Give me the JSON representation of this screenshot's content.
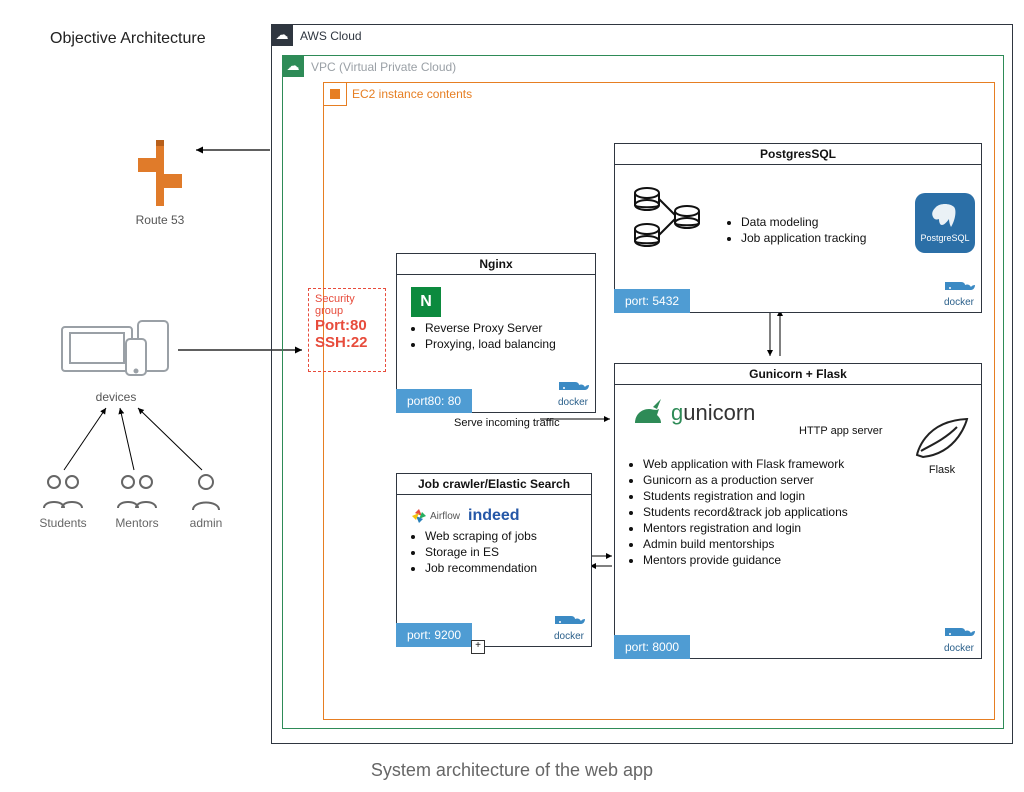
{
  "header": {
    "objective": "Objective Architecture",
    "caption": "System architecture of the web app"
  },
  "clouds": {
    "aws": "AWS Cloud",
    "vpc": "VPC (Virtual Private Cloud)",
    "ec2": "EC2 instance contents"
  },
  "security_group": {
    "title": "Security group",
    "port_line": "Port:80",
    "ssh_line": "SSH:22"
  },
  "route53": {
    "label": "Route 53"
  },
  "devices": {
    "label": "devices"
  },
  "users": {
    "students": "Students",
    "mentors": "Mentors",
    "admin": "admin"
  },
  "edges": {
    "serve_traffic": "Serve incoming traffic",
    "http_app": "HTTP app server"
  },
  "docker_label": "docker",
  "nginx": {
    "title": "Nginx",
    "bullets": [
      "Reverse Proxy Server",
      "Proxying, load balancing"
    ],
    "port": "port80: 80"
  },
  "postgres": {
    "title": "PostgresSQL",
    "badge": "PostgreSQL",
    "bullets": [
      "Data modeling",
      "Job application tracking"
    ],
    "port": "port: 5432"
  },
  "gunicorn": {
    "title": "Gunicorn + Flask",
    "logo_text": "unicorn",
    "flask_label": "Flask",
    "bullets": [
      "Web application with Flask framework",
      "Gunicorn as a production server",
      "Students registration and login",
      "Students record&track job applications",
      "Mentors registration and login",
      "Admin build mentorships",
      "Mentors provide guidance"
    ],
    "port": "port: 8000"
  },
  "crawler": {
    "title": "Job crawler/Elastic Search",
    "airflow": "Airflow",
    "indeed": "indeed",
    "bullets": [
      "Web scraping of jobs",
      "Storage in ES",
      "Job recommendation"
    ],
    "port": "port: 9200"
  }
}
